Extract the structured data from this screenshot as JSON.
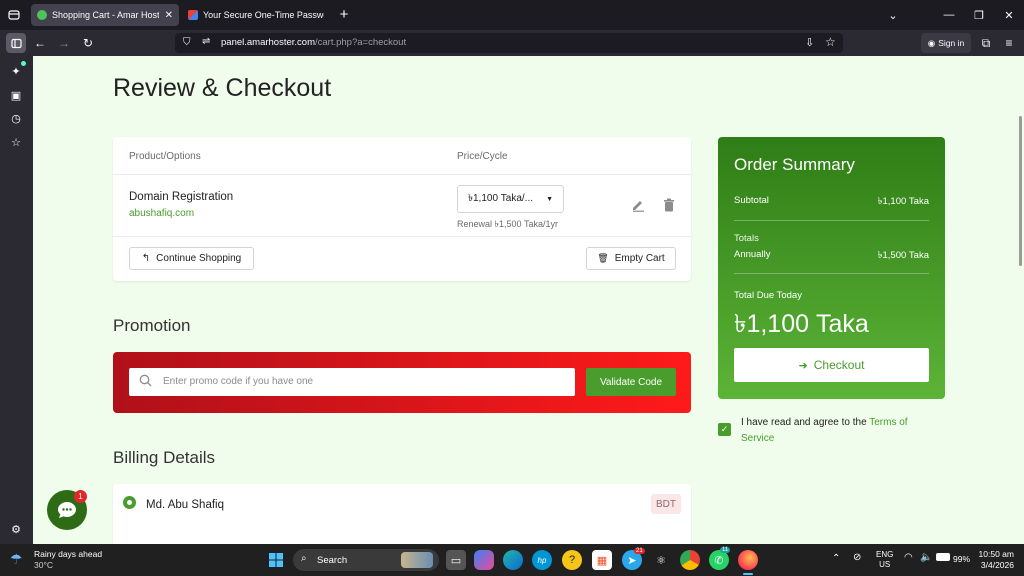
{
  "browser": {
    "tabs": [
      {
        "title": "Shopping Cart - Amar Hoster",
        "active": true
      },
      {
        "title": "Your Secure One-Time Password",
        "active": false
      }
    ],
    "url_host": "panel.amarhoster.com",
    "url_path": "/cart.php?a=checkout",
    "sign_in": "Sign in"
  },
  "page": {
    "title": "Review & Checkout",
    "cart": {
      "col_product": "Product/Options",
      "col_price": "Price/Cycle",
      "item_name": "Domain Registration",
      "item_domain": "abushafiq.com",
      "price_select": "৳1,100 Taka/...",
      "renewal": "Renewal ৳1,500 Taka/1yr",
      "continue_label": "Continue Shopping",
      "empty_label": "Empty Cart"
    },
    "promotion": {
      "heading": "Promotion",
      "placeholder": "Enter promo code if you have one",
      "validate_label": "Validate Code"
    },
    "billing": {
      "heading": "Billing Details",
      "name": "Md. Abu Shafiq",
      "currency": "BDT"
    },
    "summary": {
      "title": "Order Summary",
      "subtotal_label": "Subtotal",
      "subtotal_value": "৳1,100 Taka",
      "totals_label": "Totals",
      "annually_label": "Annually",
      "annually_value": "৳1,500 Taka",
      "due_label": "Total Due Today",
      "due_value": "৳1,100 Taka",
      "checkout_label": "Checkout"
    },
    "terms": {
      "text": "I have read and agree to the ",
      "link": "Terms of Service"
    },
    "chat_badge": "1"
  },
  "taskbar": {
    "weather_title": "Rainy days ahead",
    "weather_temp": "30°C",
    "search": "Search",
    "badge_telegram": "21",
    "badge_whatsapp": "11",
    "lang": "ENG",
    "region": "US",
    "battery": "99%",
    "time": "10:50 am",
    "date": "3/4/2026"
  },
  "colors": {
    "accent": "#4a9c2d",
    "summary_top": "#2f7d16",
    "summary_bottom": "#5cb437",
    "promo_left": "#b0101a",
    "promo_right": "#ff1a1a"
  }
}
